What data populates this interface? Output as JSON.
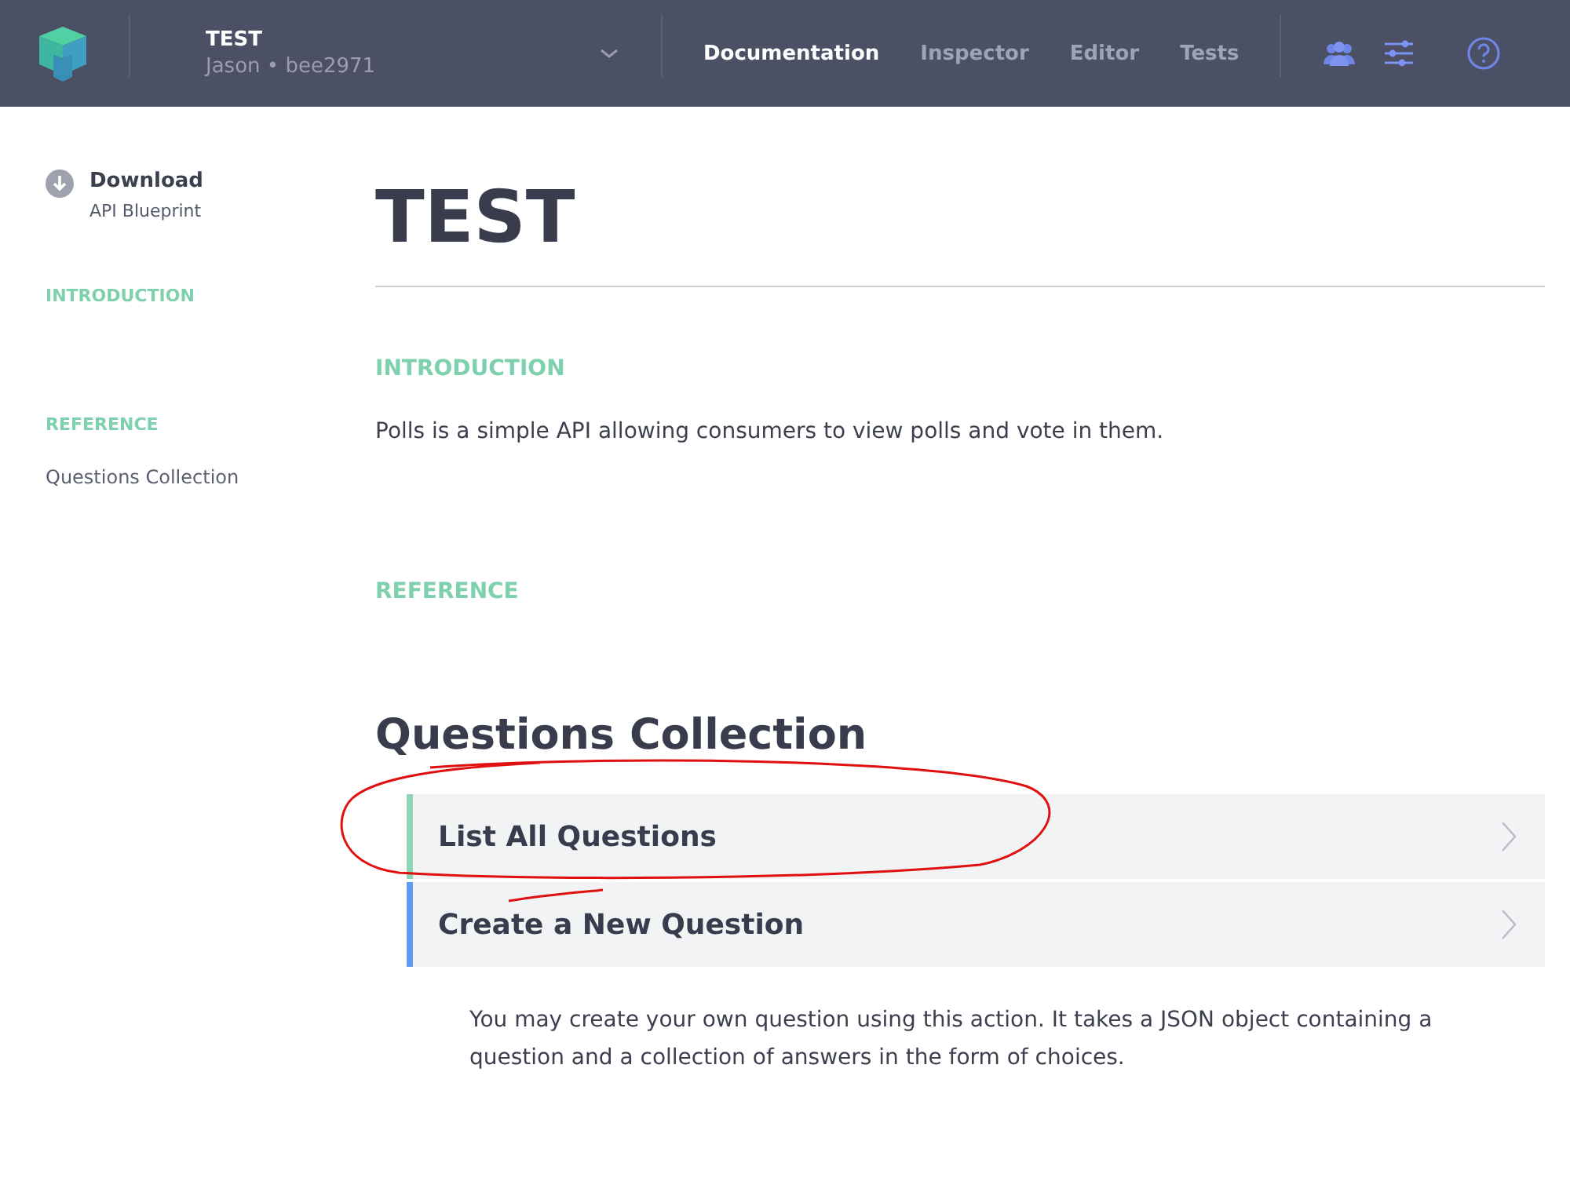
{
  "header": {
    "project": "TEST",
    "owner": "Jason • bee2971",
    "tabs": [
      {
        "label": "Documentation",
        "selected": true
      },
      {
        "label": "Inspector",
        "selected": false
      },
      {
        "label": "Editor",
        "selected": false
      },
      {
        "label": "Tests",
        "selected": false
      }
    ]
  },
  "sidebar": {
    "download": {
      "title": "Download",
      "subtitle": "API Blueprint"
    },
    "sections": [
      {
        "heading": "INTRODUCTION"
      },
      {
        "heading": "REFERENCE",
        "items": [
          "Questions Collection"
        ]
      }
    ]
  },
  "main": {
    "title": "TEST",
    "introduction": {
      "heading": "INTRODUCTION",
      "text": "Polls is a simple API allowing consumers to view polls and vote in them."
    },
    "reference": {
      "heading": "REFERENCE"
    },
    "group": {
      "title": "Questions Collection",
      "actions": [
        {
          "title": "List All Questions",
          "color": "#8dd5b6"
        },
        {
          "title": "Create a New Question",
          "color": "#5c9df0"
        }
      ],
      "description": "You may create your own question using this action. It takes a JSON object containing a question and a collection of answers in the form of choices."
    }
  }
}
